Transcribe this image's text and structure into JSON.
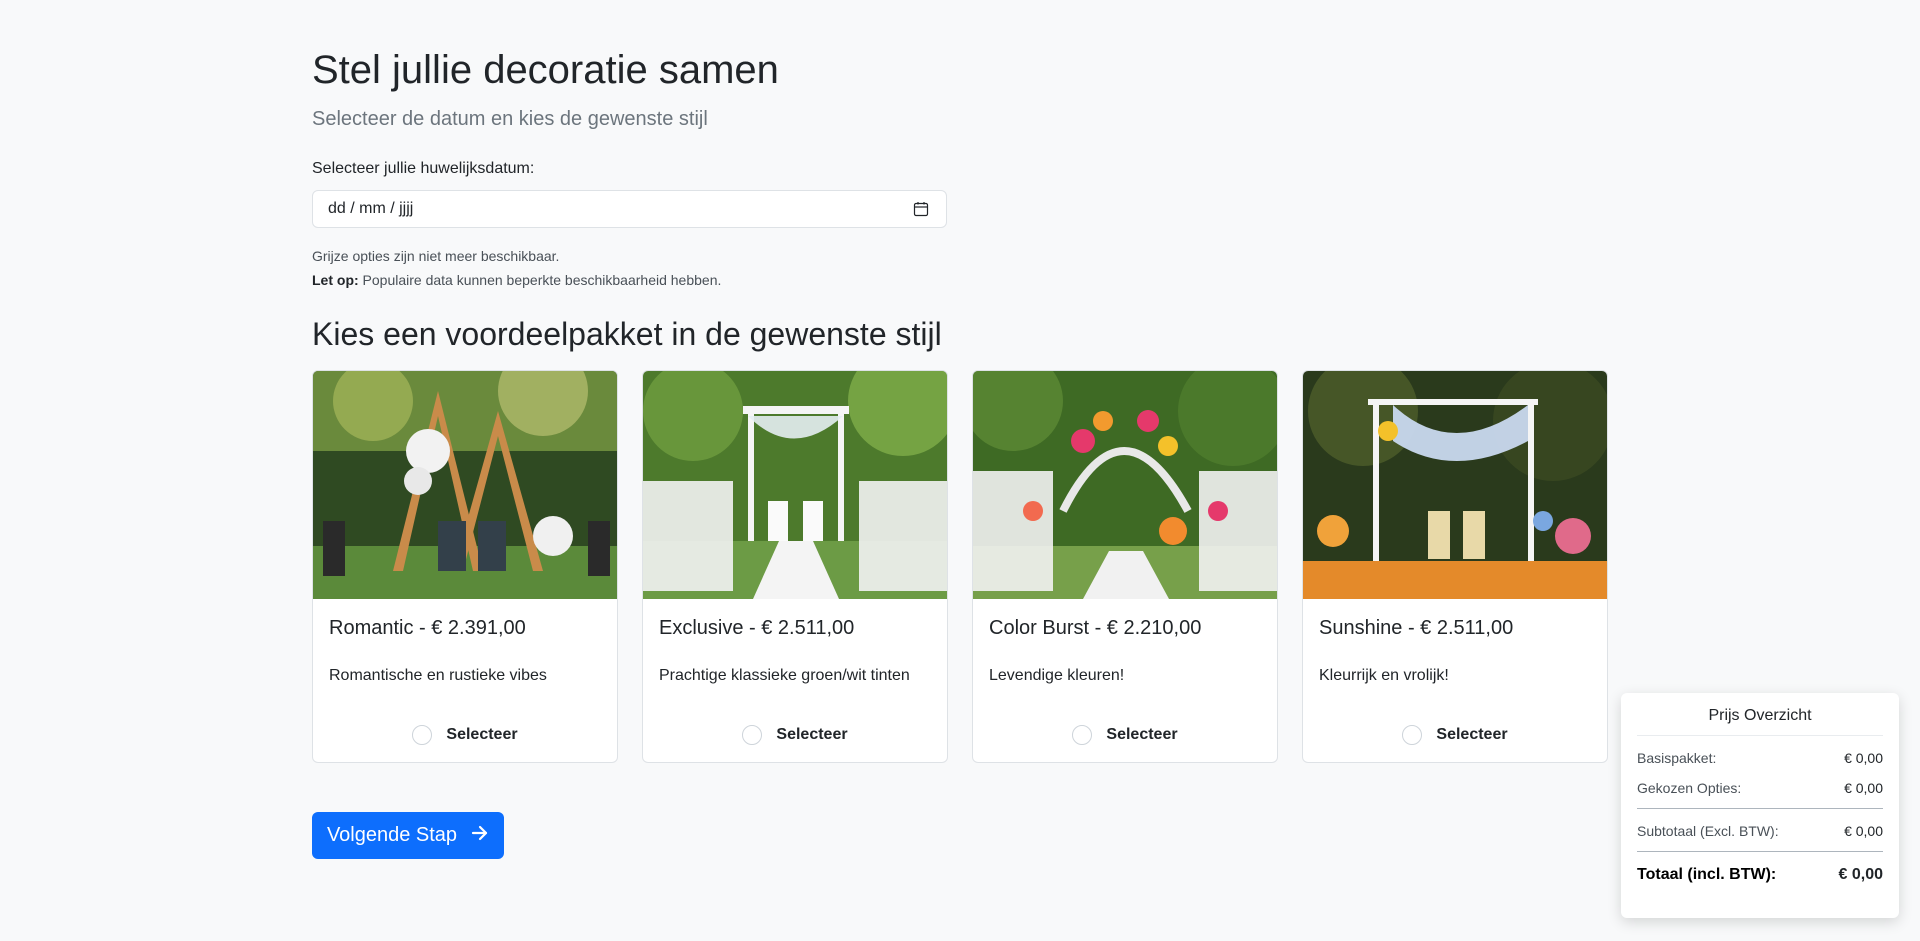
{
  "header": {
    "title": "Stel jullie decoratie samen",
    "subtitle": "Selecteer de datum en kies de gewenste stijl"
  },
  "date": {
    "label": "Selecteer jullie huwelijksdatum:",
    "placeholder": "dd / mm / jjjj"
  },
  "help": {
    "line1": "Grijze opties zijn niet meer beschikbaar.",
    "note_bold": "Let op:",
    "note_text": " Populaire data kunnen beperkte beschikbaarheid hebben."
  },
  "packages": {
    "title": "Kies een voordeelpakket in de gewenste stijl",
    "select_label": "Selecteer",
    "items": [
      {
        "title": "Romantic - € 2.391,00",
        "description": "Romantische en rustieke vibes"
      },
      {
        "title": "Exclusive - € 2.511,00",
        "description": "Prachtige klassieke groen/wit tinten"
      },
      {
        "title": "Color Burst - € 2.210,00",
        "description": "Levendige kleuren!"
      },
      {
        "title": "Sunshine - € 2.511,00",
        "description": "Kleurrijk en vrolijk!"
      }
    ]
  },
  "next_button": {
    "label": "Volgende Stap"
  },
  "price_overview": {
    "title": "Prijs Overzicht",
    "base_label": "Basispakket:",
    "base_value": "€ 0,00",
    "options_label": "Gekozen Opties:",
    "options_value": "€ 0,00",
    "subtotal_label": "Subtotaal (Excl. BTW):",
    "subtotal_value": "€ 0,00",
    "total_label": "Totaal (incl. BTW):",
    "total_value": "€ 0,00"
  },
  "colors": {
    "accent": "#0d6efd",
    "background": "#f8f9fa"
  }
}
